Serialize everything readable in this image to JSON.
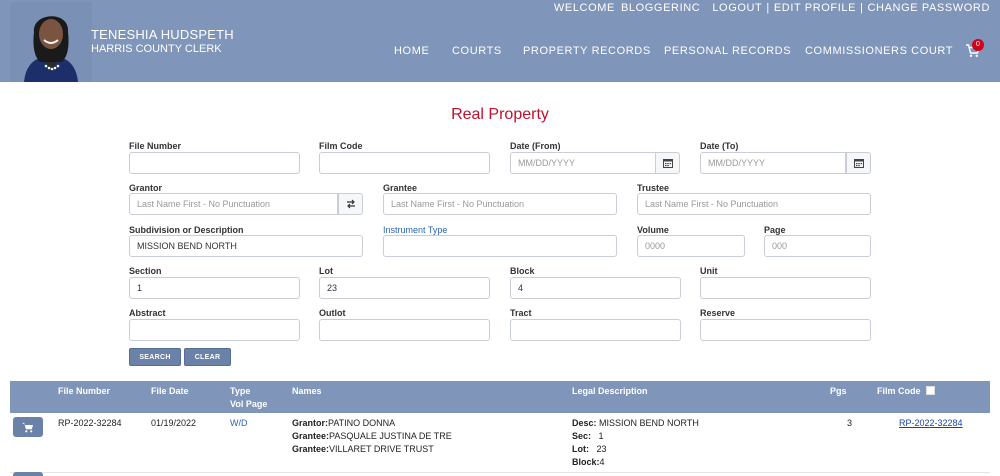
{
  "header": {
    "name": "TENESHIA HUDSPETH",
    "title": "HARRIS COUNTY CLERK",
    "welcome": "WELCOME",
    "user": "BLOGGERINC",
    "logout": "LOGOUT",
    "edit_profile": "EDIT PROFILE",
    "change_password": "CHANGE PASSWORD",
    "separator": "|",
    "nav": [
      "HOME",
      "COURTS",
      "PROPERTY RECORDS",
      "PERSONAL RECORDS",
      "COMMISSIONERS COURT"
    ],
    "cart_count": "0"
  },
  "form": {
    "title": "Real Property",
    "file_number": {
      "label": "File Number",
      "value": ""
    },
    "film_code": {
      "label": "Film Code",
      "value": ""
    },
    "date_from": {
      "label": "Date (From)",
      "placeholder": "MM/DD/YYYY"
    },
    "date_to": {
      "label": "Date (To)",
      "placeholder": "MM/DD/YYYY"
    },
    "grantor": {
      "label": "Grantor",
      "placeholder": "Last Name First - No Punctuation"
    },
    "grantee": {
      "label": "Grantee",
      "placeholder": "Last Name First - No Punctuation"
    },
    "trustee": {
      "label": "Trustee",
      "placeholder": "Last Name First - No Punctuation"
    },
    "subdivision": {
      "label": "Subdivision or Description",
      "value": "MISSION BEND NORTH"
    },
    "instrument_type": {
      "label": "Instrument Type",
      "value": ""
    },
    "volume": {
      "label": "Volume",
      "placeholder": "0000"
    },
    "page": {
      "label": "Page",
      "placeholder": "000"
    },
    "section": {
      "label": "Section",
      "value": "1"
    },
    "lot": {
      "label": "Lot",
      "value": "23"
    },
    "block": {
      "label": "Block",
      "value": "4"
    },
    "unit": {
      "label": "Unit",
      "value": ""
    },
    "abstract": {
      "label": "Abstract",
      "value": ""
    },
    "outlot": {
      "label": "Outlot",
      "value": ""
    },
    "tract": {
      "label": "Tract",
      "value": ""
    },
    "reserve": {
      "label": "Reserve",
      "value": ""
    },
    "search_label": "SEARCH",
    "clear_label": "CLEAR"
  },
  "results": {
    "columns": {
      "file_number": "File Number",
      "file_date": "File Date",
      "type_line1": "Type",
      "type_line2": "Vol Page",
      "names": "Names",
      "legal": "Legal Description",
      "pgs": "Pgs",
      "film_code": "Film Code"
    },
    "rows": [
      {
        "file_number": "RP-2022-32284",
        "file_date": "01/19/2022",
        "type": "W/D",
        "names": [
          {
            "role": "Grantor:",
            "name": "PATINO DONNA"
          },
          {
            "role": "Grantee:",
            "name": "PASQUALE JUSTINA DE TRE"
          },
          {
            "role": "Grantee:",
            "name": "VILLARET DRIVE TRUST"
          }
        ],
        "legal": [
          {
            "key": "Desc:",
            "value": "MISSION BEND NORTH"
          },
          {
            "key": "Sec:",
            "value": "1"
          },
          {
            "key": "Lot:",
            "value": "23"
          },
          {
            "key": "Block:",
            "value": "4"
          }
        ],
        "pgs": "3",
        "film_code": "RP-2022-32284"
      }
    ]
  },
  "colors": {
    "header_bg": "#7f95b9",
    "title_red": "#c0102c",
    "button_bg": "#6b82a8",
    "link_blue": "#2a66b8"
  },
  "icons": [
    "cart-icon",
    "calendar-icon",
    "swap-icon",
    "checkbox-icon"
  ]
}
